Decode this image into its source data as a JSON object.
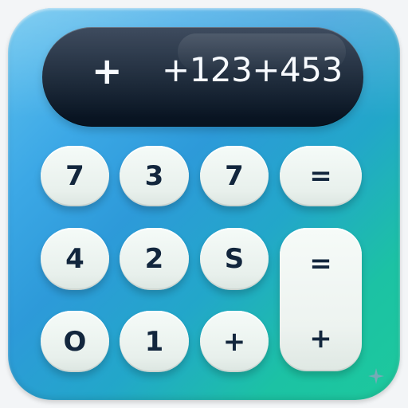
{
  "display": {
    "sign": "+",
    "expression": "+123+453"
  },
  "keypad": {
    "row1": [
      "7",
      "3",
      "7",
      "="
    ],
    "row2": [
      "4",
      "2",
      "S"
    ],
    "row3": [
      "O",
      "1",
      "+"
    ],
    "tall_key": {
      "top": "=",
      "bottom": "+"
    }
  }
}
